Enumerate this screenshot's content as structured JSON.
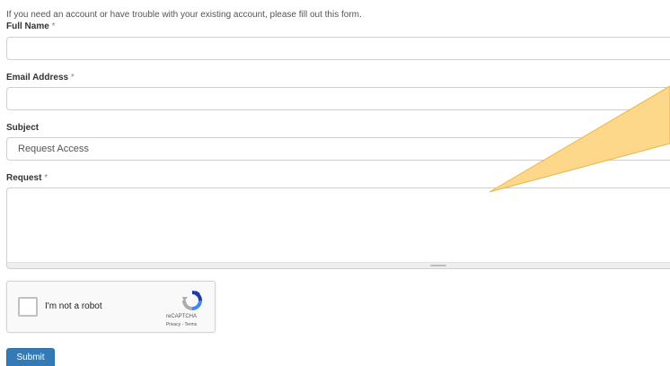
{
  "intro_text": "If you need an account or have trouble with your existing account, please fill out this form.",
  "fields": {
    "full_name": {
      "label": "Full Name",
      "required_mark": "*",
      "value": ""
    },
    "email": {
      "label": "Email Address",
      "required_mark": "*",
      "value": ""
    },
    "subject": {
      "label": "Subject",
      "selected": "Request Access"
    },
    "request": {
      "label": "Request",
      "required_mark": "*",
      "value": ""
    }
  },
  "captcha": {
    "label": "I'm not a robot",
    "brand": "reCAPTCHA",
    "links": "Privacy - Terms",
    "icon": "recaptcha-logo-icon"
  },
  "submit_label": "Submit",
  "callout_color": "#fdd78a",
  "accent_color": "#337ab7"
}
